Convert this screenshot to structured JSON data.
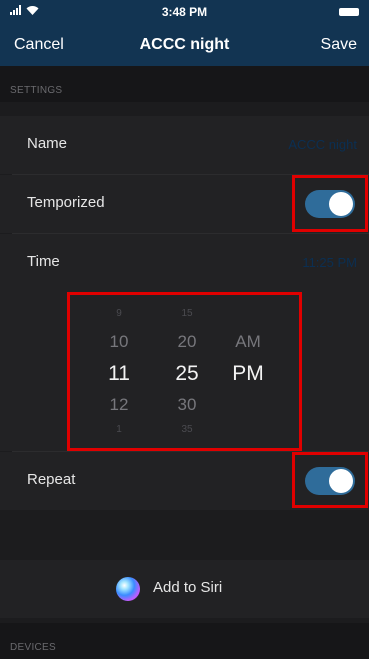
{
  "status_bar": {
    "time": "3:48 PM"
  },
  "nav": {
    "cancel_label": "Cancel",
    "title": "ACCC night",
    "save_label": "Save"
  },
  "settings_section": {
    "header": "SETTINGS"
  },
  "rows": {
    "name": {
      "label": "Name",
      "value": "ACCC night"
    },
    "temporized": {
      "label": "Temporized",
      "enabled": true
    },
    "time": {
      "label": "Time",
      "value": "11:25 PM"
    },
    "repeat": {
      "label": "Repeat",
      "enabled": true
    }
  },
  "time_picker": {
    "hours": [
      "9",
      "10",
      "11",
      "12",
      "1"
    ],
    "minutes": [
      "15",
      "20",
      "25",
      "30",
      "35"
    ],
    "periods": [
      "AM",
      "PM"
    ],
    "selected_hour": "11",
    "selected_minute": "25",
    "selected_period": "PM"
  },
  "siri": {
    "label": "Add to Siri"
  },
  "devices_section": {
    "header": "DEVICES"
  },
  "colors": {
    "nav_background": "#123452",
    "toggle_on": "#2f6c9a",
    "highlight_box": "#e00000"
  }
}
